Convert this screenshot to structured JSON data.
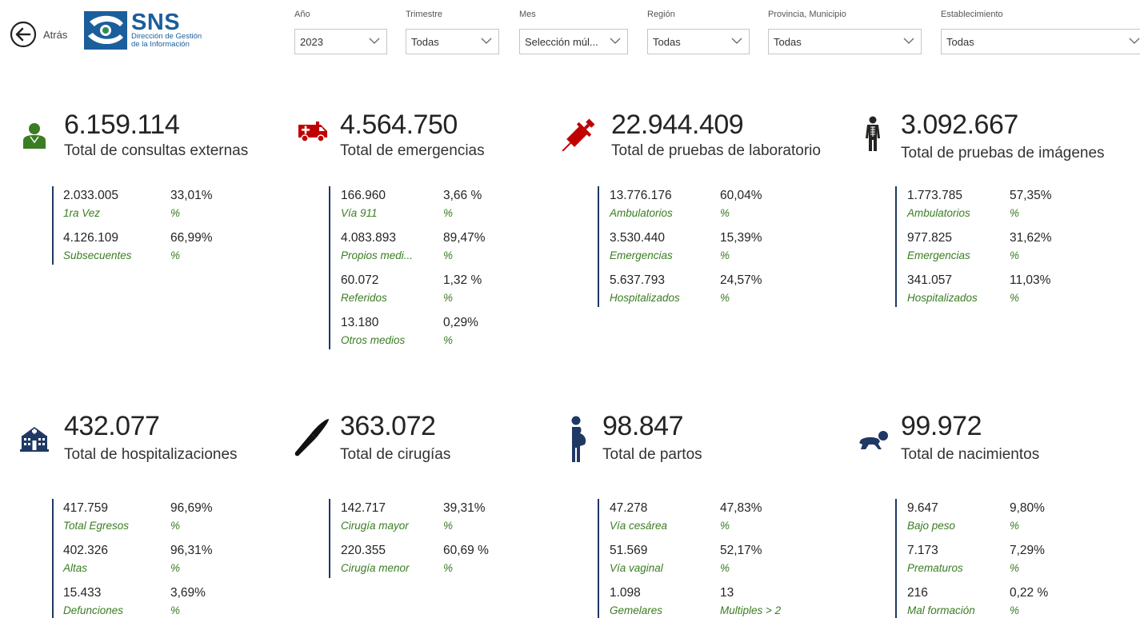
{
  "header": {
    "back_label": "Atrás",
    "logo_title": "SNS",
    "logo_sub1": "Dirección de Gestión",
    "logo_sub2": "de la Información"
  },
  "filters": [
    {
      "label": "Año",
      "value": "2023"
    },
    {
      "label": "Trimestre",
      "value": "Todas"
    },
    {
      "label": "Mes",
      "value": "Selección múl..."
    },
    {
      "label": "Región",
      "value": "Todas"
    },
    {
      "label": "Provincia, Municipio",
      "value": "Todas"
    },
    {
      "label": "Establecimiento",
      "value": "Todas"
    }
  ],
  "cards": [
    {
      "icon": "doctor-icon",
      "total": "6.159.114",
      "title": "Total de consultas externas",
      "rows": [
        {
          "value": "2.033.005",
          "pct": "33,01%",
          "label": "1ra Vez",
          "unit": "%"
        },
        {
          "value": "4.126.109",
          "pct": "66,99%",
          "label": "Subsecuentes",
          "unit": "%"
        }
      ]
    },
    {
      "icon": "ambulance-icon",
      "total": "4.564.750",
      "title": "Total de emergencias",
      "rows": [
        {
          "value": "166.960",
          "pct": "3,66 %",
          "label": "Vía 911",
          "unit": "%"
        },
        {
          "value": "4.083.893",
          "pct": "89,47%",
          "label": "Propios medi...",
          "unit": "%"
        },
        {
          "value": "60.072",
          "pct": "1,32 %",
          "label": "Referidos",
          "unit": "%"
        },
        {
          "value": "13.180",
          "pct": "0,29%",
          "label": "Otros medios",
          "unit": "%"
        }
      ]
    },
    {
      "icon": "syringe-icon",
      "total": "22.944.409",
      "title": "Total de pruebas de laboratorio",
      "rows": [
        {
          "value": "13.776.176",
          "pct": "60,04%",
          "label": "Ambulatorios",
          "unit": "%"
        },
        {
          "value": "3.530.440",
          "pct": "15,39%",
          "label": "Emergencias",
          "unit": "%"
        },
        {
          "value": "5.637.793",
          "pct": "24,57%",
          "label": "Hospitalizados",
          "unit": "%"
        }
      ]
    },
    {
      "icon": "xray-body-icon",
      "total": "3.092.667",
      "title": "Total de pruebas de imágenes",
      "rows": [
        {
          "value": "1.773.785",
          "pct": "57,35%",
          "label": "Ambulatorios",
          "unit": "%"
        },
        {
          "value": "977.825",
          "pct": "31,62%",
          "label": "Emergencias",
          "unit": "%"
        },
        {
          "value": "341.057",
          "pct": "11,03%",
          "label": "Hospitalizados",
          "unit": "%"
        }
      ]
    },
    {
      "icon": "hospital-building-icon",
      "total": "432.077",
      "title": "Total de hospitalizaciones",
      "rows": [
        {
          "value": "417.759",
          "pct": "96,69%",
          "label": "Total Egresos",
          "unit": "%"
        },
        {
          "value": "402.326",
          "pct": "96,31%",
          "label": "Altas",
          "unit": "%"
        },
        {
          "value": "15.433",
          "pct": "3,69%",
          "label": "Defunciones",
          "unit": "%"
        }
      ]
    },
    {
      "icon": "scalpel-icon",
      "total": "363.072",
      "title": "Total de cirugías",
      "rows": [
        {
          "value": "142.717",
          "pct": "39,31%",
          "label": "Cirugía mayor",
          "unit": "%"
        },
        {
          "value": "220.355",
          "pct": "60,69 %",
          "label": "Cirugía menor",
          "unit": "%"
        }
      ]
    },
    {
      "icon": "pregnant-woman-icon",
      "total": "98.847",
      "title": "Total de partos",
      "rows": [
        {
          "value": "47.278",
          "pct": "47,83%",
          "label": "Vía cesárea",
          "unit": "%"
        },
        {
          "value": "51.569",
          "pct": "52,17%",
          "label": "Vía vaginal",
          "unit": "%"
        },
        {
          "value": "1.098",
          "pct": "13",
          "label": "Gemelares",
          "unit": "Multiples > 2"
        }
      ]
    },
    {
      "icon": "crawling-baby-icon",
      "total": "99.972",
      "title": "Total de nacimientos",
      "rows": [
        {
          "value": "9.647",
          "pct": "9,80%",
          "label": "Bajo peso",
          "unit": "%"
        },
        {
          "value": "7.173",
          "pct": "7,29%",
          "label": "Prematuros",
          "unit": "%"
        },
        {
          "value": "216",
          "pct": "0,22 %",
          "label": "Mal formación",
          "unit": "%"
        }
      ]
    }
  ]
}
